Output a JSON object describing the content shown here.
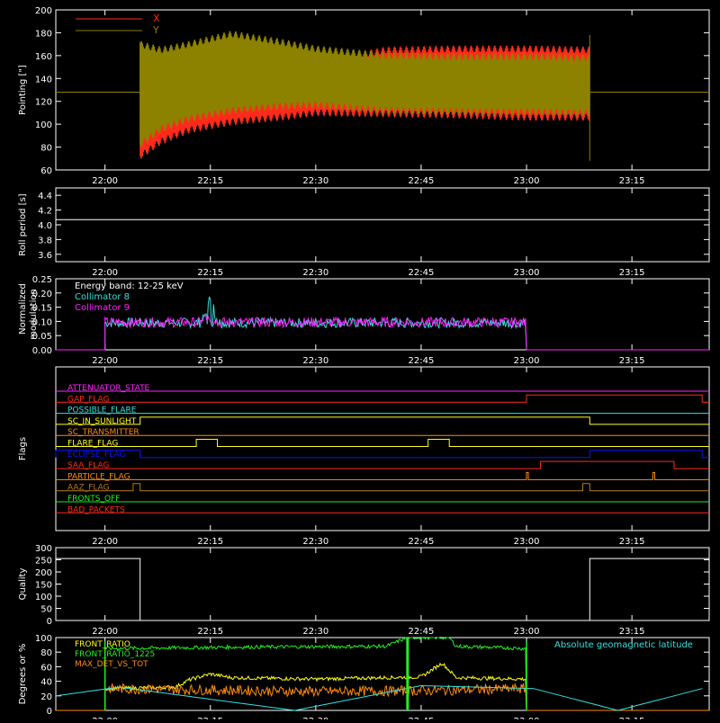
{
  "colors": {
    "background": "#000000",
    "axis": "#ffffff",
    "red": "#ff2a1a",
    "olive": "#8c8200",
    "cyan": "#35e0e0",
    "magenta": "#ff22ff",
    "yellow": "#ffff20",
    "green": "#22ee22",
    "orange": "#ff8a10",
    "blue": "#1010ff",
    "brown": "#b87a18"
  },
  "time_ticks": [
    "22:00",
    "22:15",
    "22:30",
    "22:45",
    "23:00",
    "23:15"
  ],
  "chart_data": [
    {
      "id": "pointing",
      "type": "line",
      "ylabel": "Pointing [\"]",
      "ylim": [
        60,
        200
      ],
      "yticks": [
        60,
        80,
        100,
        120,
        140,
        160,
        180,
        200
      ],
      "legend": [
        "X",
        "Y"
      ],
      "series": [
        {
          "name": "X",
          "color": "#ff2a1a",
          "x": [
            "22:05",
            "22:08",
            "22:12",
            "22:18",
            "22:25",
            "22:30",
            "22:40",
            "22:50",
            "23:00",
            "23:09"
          ],
          "upper": [
            168,
            155,
            150,
            150,
            151,
            154,
            165,
            166,
            166,
            165
          ],
          "lower": [
            72,
            85,
            95,
            102,
            106,
            110,
            109,
            108,
            106,
            106
          ]
        },
        {
          "name": "Y",
          "color": "#8c8200",
          "x": [
            "22:05",
            "22:08",
            "22:12",
            "22:18",
            "22:25",
            "22:30",
            "22:40",
            "22:50",
            "23:00",
            "23:09"
          ],
          "upper": [
            170,
            165,
            170,
            179,
            172,
            166,
            160,
            159,
            159,
            158
          ],
          "lower": [
            82,
            96,
            105,
            112,
            116,
            117,
            112,
            111,
            111,
            110
          ]
        }
      ],
      "baseline": 128
    },
    {
      "id": "roll_period",
      "type": "line",
      "ylabel": "Roll period [s]",
      "ylim": [
        3.5,
        4.5
      ],
      "yticks": [
        3.6,
        3.8,
        4.0,
        4.2,
        4.4
      ],
      "series": [
        {
          "color": "#ffffff",
          "value": 4.07
        }
      ]
    },
    {
      "id": "modulation",
      "type": "line",
      "ylabel": "Normalized modulation",
      "ylim": [
        0,
        0.25
      ],
      "yticks": [
        0.0,
        0.05,
        0.1,
        0.15,
        0.2,
        0.25
      ],
      "annotation": "Energy band: 12-25 keV",
      "series": [
        {
          "name": "Collimator 8",
          "color": "#35e0e0",
          "start": "22:00",
          "end": "23:00",
          "level": 0.095,
          "peak_time": "22:15",
          "peak": 0.205
        },
        {
          "name": "Collimator 9",
          "color": "#ff22ff",
          "start": "22:00",
          "end": "23:00",
          "level": 0.097,
          "peak_time": "22:15",
          "peak": 0.13
        }
      ]
    },
    {
      "id": "flags",
      "type": "line",
      "ylabel": "Flags",
      "series": [
        {
          "name": "ATTENUATOR_STATE",
          "color": "#ff22ff",
          "segments": []
        },
        {
          "name": "GAP_FLAG",
          "color": "#ff2a1a",
          "segments": [
            [
              "23:00",
              "23:25"
            ]
          ]
        },
        {
          "name": "POSSIBLE_FLARE",
          "color": "#35e0e0",
          "segments": []
        },
        {
          "name": "SC_IN_SUNLIGHT",
          "color": "#ffff20",
          "segments": [
            [
              "22:05",
              "23:09"
            ]
          ]
        },
        {
          "name": "SC_TRANSMITTER",
          "color": "#ff8a10",
          "segments": []
        },
        {
          "name": "FLARE_FLAG",
          "color": "#ffff20",
          "segments": [
            [
              "22:13",
              "22:16"
            ],
            [
              "22:46",
              "22:49"
            ]
          ]
        },
        {
          "name": "ECLIPSE_FLAG",
          "color": "#1010ff",
          "segments": [
            [
              "21:53",
              "22:05"
            ],
            [
              "23:09",
              "23:25"
            ]
          ]
        },
        {
          "name": "SAA_FLAG",
          "color": "#ff2a1a",
          "segments": [
            [
              "23:02",
              "23:21"
            ]
          ]
        },
        {
          "name": "PARTICLE_FLAG",
          "color": "#ff8a10",
          "segments": [
            [
              "23:00",
              "23:00"
            ],
            [
              "23:18",
              "23:18"
            ]
          ]
        },
        {
          "name": "AAZ_FLAG",
          "color": "#b87a18",
          "segments": [
            [
              "22:04",
              "22:05"
            ],
            [
              "23:08",
              "23:09"
            ]
          ]
        },
        {
          "name": "FRONTS_OFF",
          "color": "#22ee22",
          "segments": []
        },
        {
          "name": "BAD_PACKETS",
          "color": "#ff2a1a",
          "segments": []
        }
      ]
    },
    {
      "id": "quality",
      "type": "line",
      "ylabel": "Quality",
      "ylim": [
        0,
        300
      ],
      "yticks": [
        0,
        50,
        100,
        150,
        200,
        250,
        300
      ],
      "series": [
        {
          "color": "#ffffff",
          "high": 255,
          "low": 0,
          "low_start": "22:05",
          "low_end": "23:09"
        }
      ]
    },
    {
      "id": "ratios",
      "type": "line",
      "ylabel": "Degrees or %",
      "ylim": [
        0,
        100
      ],
      "yticks": [
        0,
        20,
        40,
        60,
        80,
        100
      ],
      "right_legend": "Absolute geomagnetic latitude",
      "series": [
        {
          "name": "FRONT_RATIO",
          "color": "#ffff20",
          "points": [
            [
              "22:00",
              30
            ],
            [
              "22:10",
              32
            ],
            [
              "22:12",
              42
            ],
            [
              "22:15",
              50
            ],
            [
              "22:18",
              45
            ],
            [
              "22:30",
              43
            ],
            [
              "22:45",
              46
            ],
            [
              "22:48",
              65
            ],
            [
              "22:50",
              45
            ],
            [
              "23:00",
              43
            ]
          ]
        },
        {
          "name": "FRONT_RATIO_1225",
          "color": "#22ee22",
          "points": [
            [
              "22:00",
              85
            ],
            [
              "22:20",
              87
            ],
            [
              "22:40",
              88
            ],
            [
              "22:43",
              100
            ],
            [
              "22:49",
              100
            ],
            [
              "22:50",
              88
            ],
            [
              "23:00",
              85
            ]
          ]
        },
        {
          "name": "MAX_DET_VS_TOT",
          "color": "#ff8a10",
          "points": [
            [
              "22:00",
              30
            ],
            [
              "22:15",
              28
            ],
            [
              "22:30",
              26
            ],
            [
              "22:45",
              27
            ],
            [
              "23:00",
              30
            ]
          ]
        },
        {
          "name": "Absolute geomagnetic latitude",
          "color": "#35e0e0",
          "points": [
            [
              "21:53",
              20
            ],
            [
              "22:02",
              32
            ],
            [
              "22:27",
              0
            ],
            [
              "22:45",
              34
            ],
            [
              "23:01",
              30
            ],
            [
              "23:13",
              0
            ],
            [
              "23:25",
              30
            ]
          ]
        }
      ],
      "spike_time": "22:43"
    }
  ]
}
